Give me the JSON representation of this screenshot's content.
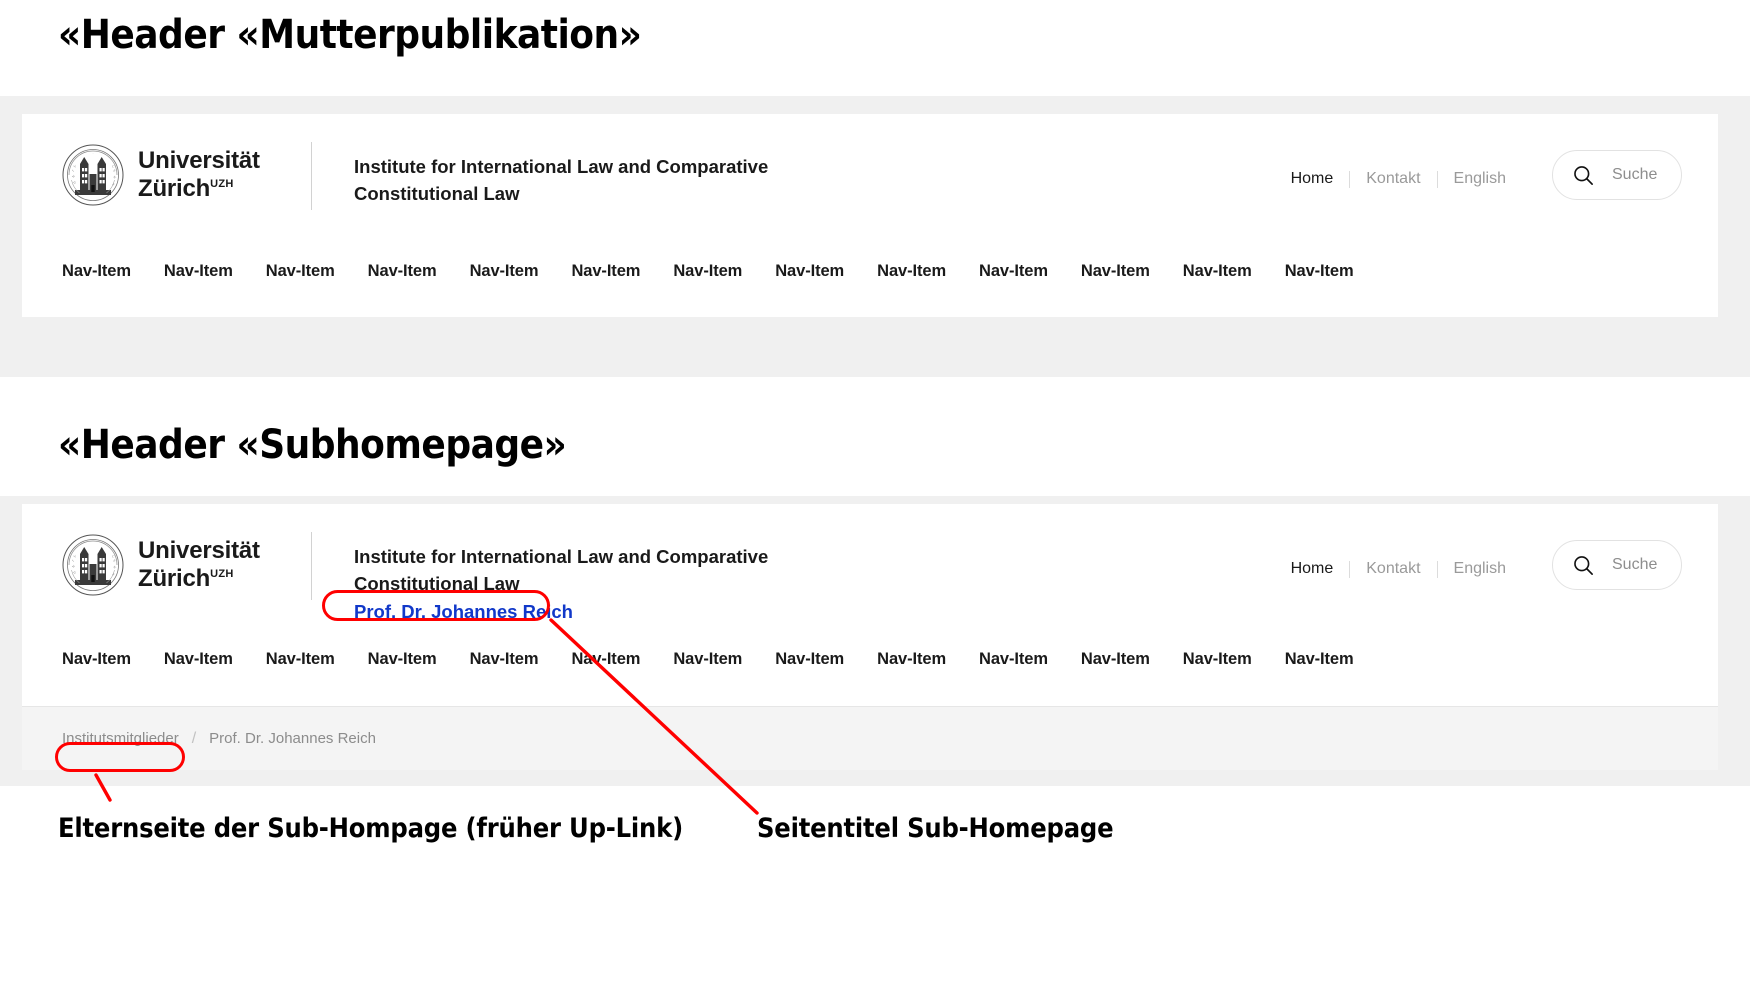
{
  "annotations": {
    "title_mutterpublikation": "«Header «Mutterpublikation»",
    "title_subhomepage": "«Header «Subhomepage»",
    "caption_parent_page": "Elternseite der Sub-Hompage (früher Up-Link)",
    "caption_page_title": "Seitentitel Sub-Homepage",
    "highlight_color": "#ff0000"
  },
  "brand": {
    "name_line1": "Universität",
    "name_line2": "Zürich",
    "superscript": "UZH"
  },
  "header_parent": {
    "institute_line1": "Institute for International Law and Comparative",
    "institute_line2": "Constitutional Law",
    "meta_links": [
      {
        "label": "Home",
        "active": true
      },
      {
        "label": "Kontakt",
        "active": false
      },
      {
        "label": "English",
        "active": false
      }
    ],
    "search": {
      "label": "Suche",
      "icon": "search-icon"
    },
    "nav_items": [
      "Nav-Item",
      "Nav-Item",
      "Nav-Item",
      "Nav-Item",
      "Nav-Item",
      "Nav-Item",
      "Nav-Item",
      "Nav-Item",
      "Nav-Item",
      "Nav-Item",
      "Nav-Item",
      "Nav-Item",
      "Nav-Item"
    ]
  },
  "header_sub": {
    "institute_line1": "Institute for International Law and Comparative",
    "institute_line2": "Constitutional Law",
    "page_title": "Prof. Dr. Johannes Reich",
    "page_title_color": "#1138c9",
    "meta_links": [
      {
        "label": "Home",
        "active": true
      },
      {
        "label": "Kontakt",
        "active": false
      },
      {
        "label": "English",
        "active": false
      }
    ],
    "search": {
      "label": "Suche",
      "icon": "search-icon"
    },
    "nav_items": [
      "Nav-Item",
      "Nav-Item",
      "Nav-Item",
      "Nav-Item",
      "Nav-Item",
      "Nav-Item",
      "Nav-Item",
      "Nav-Item",
      "Nav-Item",
      "Nav-Item",
      "Nav-Item",
      "Nav-Item",
      "Nav-Item"
    ],
    "breadcrumb": {
      "parent": "Institutsmitglieder",
      "separator": "/",
      "current": "Prof. Dr. Johannes Reich"
    }
  }
}
